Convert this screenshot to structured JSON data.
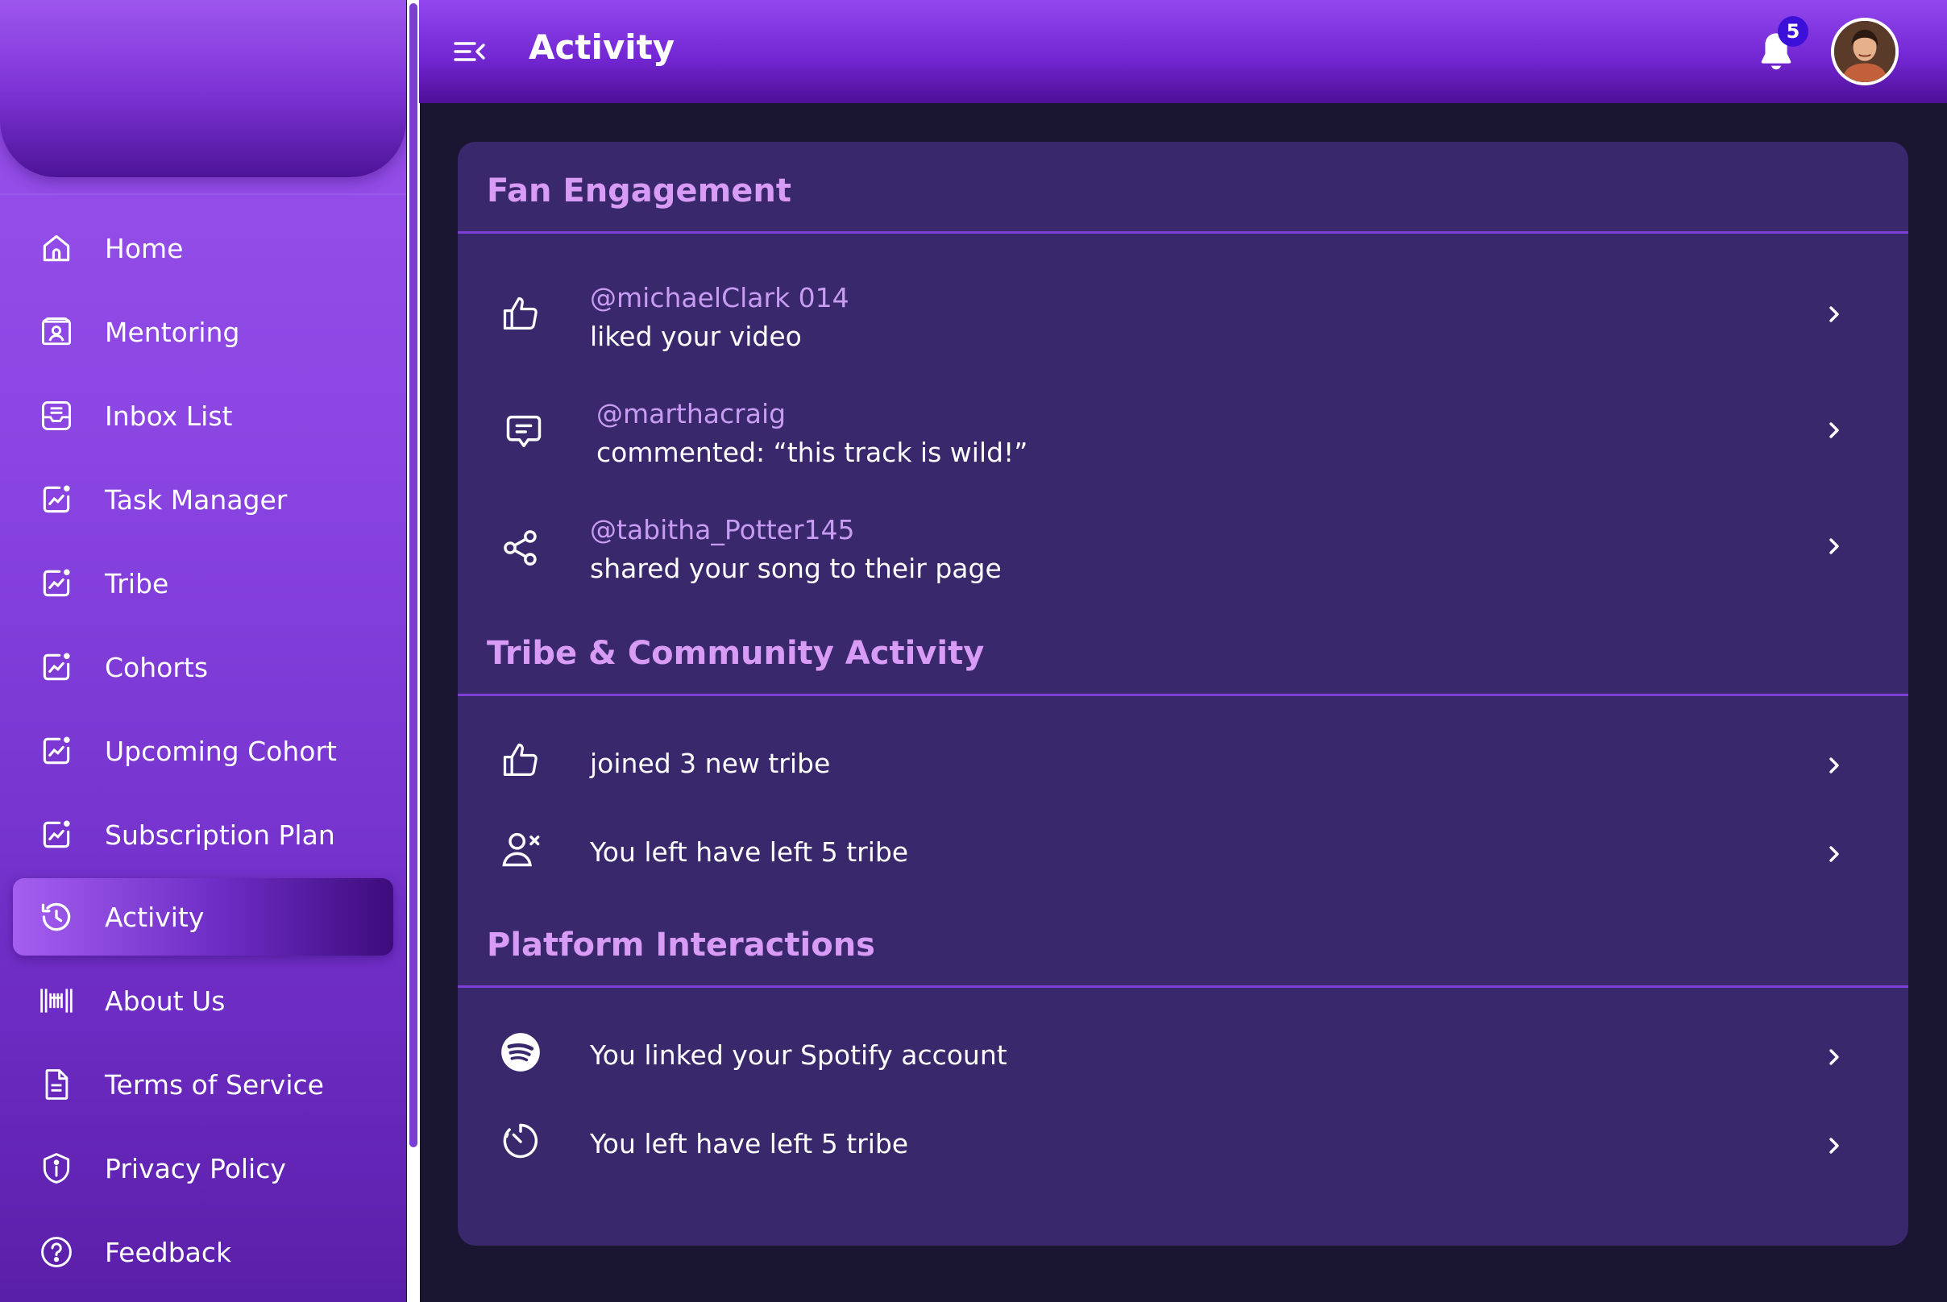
{
  "header": {
    "title": "Activity",
    "notification_count": "5"
  },
  "sidebar": {
    "items": [
      {
        "label": "Home",
        "icon": "home-icon"
      },
      {
        "label": "Mentoring",
        "icon": "mentoring-icon"
      },
      {
        "label": "Inbox List",
        "icon": "inbox-icon"
      },
      {
        "label": "Task Manager",
        "icon": "chart-edit-icon"
      },
      {
        "label": "Tribe",
        "icon": "chart-edit-icon"
      },
      {
        "label": "Cohorts",
        "icon": "chart-edit-icon"
      },
      {
        "label": "Upcoming Cohort",
        "icon": "chart-edit-icon"
      },
      {
        "label": "Subscription Plan",
        "icon": "chart-edit-icon"
      },
      {
        "label": "Activity",
        "icon": "history-icon",
        "active": true
      },
      {
        "label": "About Us",
        "icon": "barcode-icon"
      },
      {
        "label": "Terms of Service",
        "icon": "document-icon"
      },
      {
        "label": "Privacy Policy",
        "icon": "shield-info-icon"
      },
      {
        "label": "Feedback",
        "icon": "help-circle-icon"
      }
    ]
  },
  "sections": [
    {
      "title": "Fan Engagement",
      "rows": [
        {
          "icon": "thumbs-up-icon",
          "handle": "@michaelClark 014",
          "text": "liked your video"
        },
        {
          "icon": "comment-icon",
          "handle": "@marthacraig",
          "text": "commented: “this track is wild!”"
        },
        {
          "icon": "share-icon",
          "handle": "@tabitha_Potter145",
          "text": "shared your song to their page"
        }
      ]
    },
    {
      "title": "Tribe & Community Activity",
      "rows": [
        {
          "icon": "thumbs-up-icon",
          "text": "joined 3 new tribe"
        },
        {
          "icon": "user-remove-icon",
          "text": "You left have left 5 tribe"
        }
      ]
    },
    {
      "title": "Platform Interactions",
      "rows": [
        {
          "icon": "spotify-icon",
          "text": "You linked your Spotify account"
        },
        {
          "icon": "timer-icon",
          "text": "You left have left 5 tribe"
        }
      ]
    }
  ],
  "colors": {
    "sidebar_top": "#9a52ec",
    "sidebar_bottom": "#5a1fa8",
    "card_bg": "#39286c",
    "section_title": "#d99cf6",
    "handle_text": "#c79cf2",
    "divider": "#7d3fd6",
    "page_bg": "#1a1530"
  }
}
